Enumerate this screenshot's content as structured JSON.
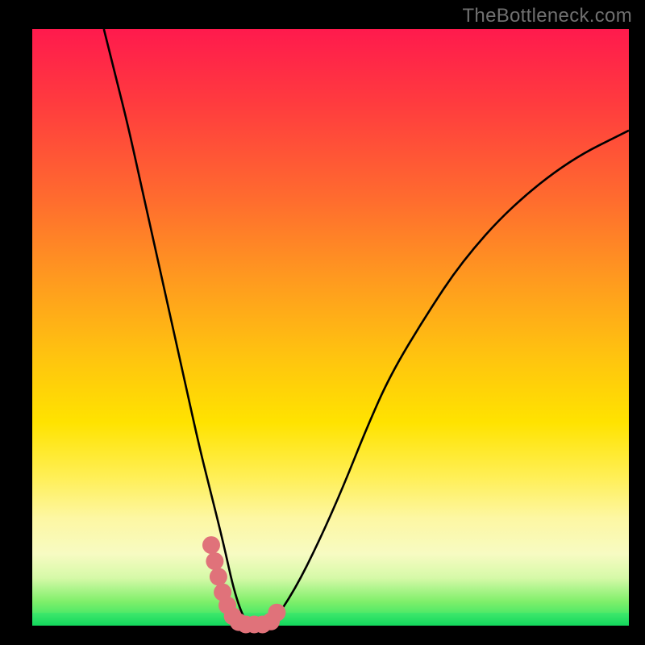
{
  "watermark": "TheBottleneck.com",
  "colors": {
    "curve": "#000000",
    "accent_pink": "#e0727a",
    "accent_pink_stroke": "#d45d66",
    "background_black": "#000000"
  },
  "chart_data": {
    "type": "line",
    "title": "",
    "xlabel": "",
    "ylabel": "",
    "xlim": [
      0,
      100
    ],
    "ylim": [
      0,
      100
    ],
    "grid": false,
    "legend": false,
    "note": "V-shaped bottleneck curve; minimum (0) around x≈34–40.",
    "series": [
      {
        "name": "bottleneck-curve",
        "x": [
          12,
          14,
          16,
          18,
          20,
          22,
          24,
          26,
          28,
          30,
          32,
          34,
          36,
          38,
          40,
          44,
          48,
          52,
          56,
          60,
          66,
          72,
          80,
          90,
          100
        ],
        "y": [
          100,
          92,
          84,
          75,
          66,
          57,
          48,
          39,
          30,
          22,
          14,
          5,
          0,
          0,
          0,
          6,
          14,
          23,
          33,
          42,
          52,
          61,
          70,
          78,
          83
        ]
      }
    ],
    "annotation": {
      "name": "accent-dots-minimum",
      "approx_x_range": [
        30,
        41
      ],
      "approx_y_range": [
        0,
        14
      ],
      "points": [
        {
          "x": 30.0,
          "y": 13.5
        },
        {
          "x": 30.6,
          "y": 10.8
        },
        {
          "x": 31.2,
          "y": 8.2
        },
        {
          "x": 31.9,
          "y": 5.6
        },
        {
          "x": 32.7,
          "y": 3.4
        },
        {
          "x": 33.6,
          "y": 1.6
        },
        {
          "x": 34.6,
          "y": 0.6
        },
        {
          "x": 35.8,
          "y": 0.2
        },
        {
          "x": 37.2,
          "y": 0.2
        },
        {
          "x": 38.6,
          "y": 0.2
        },
        {
          "x": 40.0,
          "y": 0.7
        },
        {
          "x": 41.0,
          "y": 2.2
        }
      ]
    },
    "gradient_scale": {
      "description": "vertical color fill from red (high) to green (low)",
      "high_color": "#ff1a4d",
      "low_color": "#13d85d"
    }
  }
}
